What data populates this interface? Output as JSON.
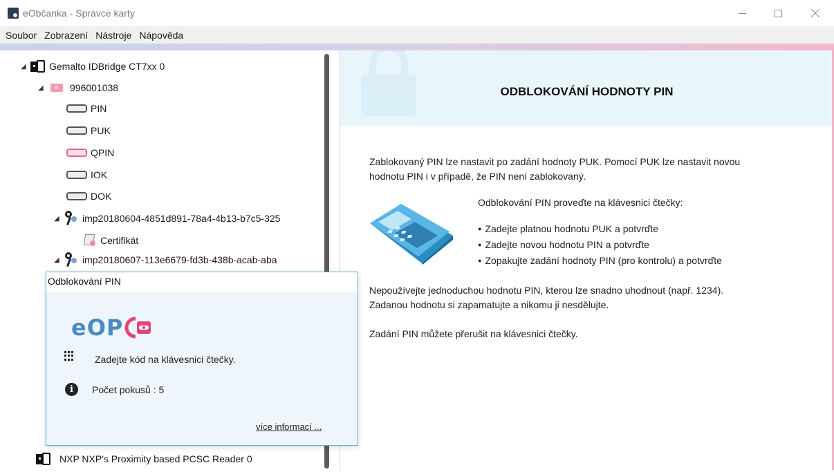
{
  "window": {
    "title": "eObčanka - Správce karty"
  },
  "menu": [
    "Soubor",
    "Zobrazení",
    "Nástroje",
    "Nápověda"
  ],
  "tree": {
    "reader1": "Gemalto IDBridge CT7xx 0",
    "card": "996001038",
    "items": [
      "PIN",
      "PUK",
      "QPIN",
      "IOK",
      "DOK"
    ],
    "cert1": "imp20180604-4851d891-78a4-4b13-b7c5-325",
    "cert1_child": "Certifikát",
    "cert2": "imp20180607-113e6679-fd3b-438b-acab-aba",
    "reader2": "NXP NXP's Proximity based PCSC Reader 0"
  },
  "content": {
    "title": "ODBLOKOVÁNÍ HODNOTY PIN",
    "intro_line1": "Zablokovaný PIN lze nastavit po zadání hodnoty PUK. Pomocí PUK lze nastavit novou",
    "intro_line2": "hodnotu PIN i v případě, že PIN není zablokovaný.",
    "instruction": "Odblokování PIN proveďte na klávesnici čtečky:",
    "steps": [
      "Zadejte platnou hodnotu PUK a potvrďte",
      "Zadejte novou hodnotu PIN a potvrďte",
      "Zopakujte zadání hodnoty PIN (pro kontrolu) a potvrďte"
    ],
    "warning_line1": "Nepoužívejte jednoduchou hodnotu PIN, kterou lze snadno uhodnout (např. 1234).",
    "warning_line2": "Zadanou hodnotu si zapamatujte a nikomu ji nesdělujte.",
    "cancel_note": "Zadání PIN můžete přerušit na klávesnici čtečky."
  },
  "dialog": {
    "title": "Odblokování PIN",
    "logo_text": "eOP",
    "prompt": "Zadejte kód na klávesnici čtečky.",
    "attempts": "Počet pokusů : 5",
    "more_link": "více informací ..."
  },
  "colors": {
    "accent_pink": "#e0457b",
    "accent_blue": "#4a8bc5",
    "header_band": "#e8f6fc"
  }
}
